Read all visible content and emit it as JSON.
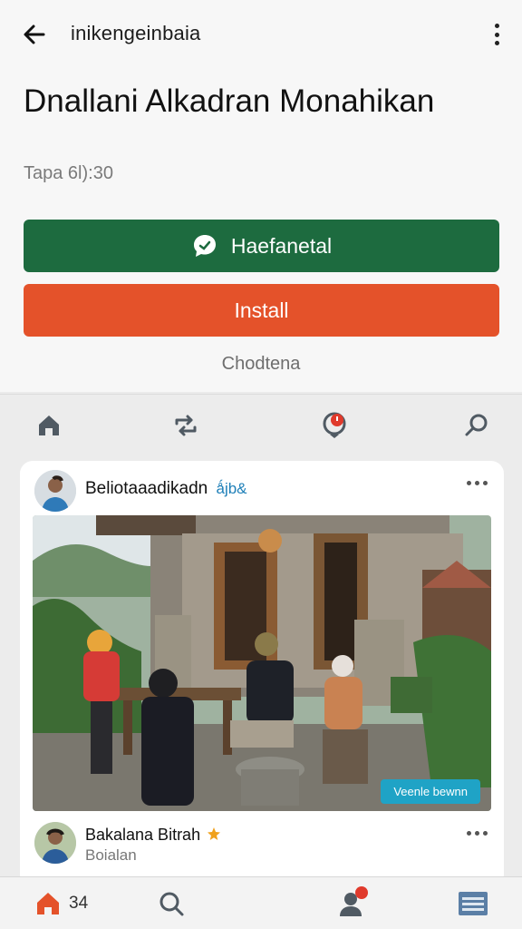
{
  "topbar": {
    "title": "inikengeinbaia"
  },
  "app": {
    "title": "Dnallani Alkadran Monahikan",
    "meta": "Tapa 6l):30"
  },
  "actions": {
    "primary_label": "Haefanetal",
    "install_label": "Install",
    "secondary_link": "Chodtena"
  },
  "feed": {
    "post": {
      "author": "Beliotaaadikadn",
      "tag": "ǻjb&",
      "photo_badge": "Veenle bewnn"
    },
    "comment": {
      "name": "Bakalana Bitrah",
      "sub": "Boialan"
    }
  },
  "bottomnav": {
    "home_count": "34"
  },
  "colors": {
    "primary_green": "#1d6b3f",
    "install_orange": "#e4522a",
    "badge_blue": "#1fa3c6"
  }
}
